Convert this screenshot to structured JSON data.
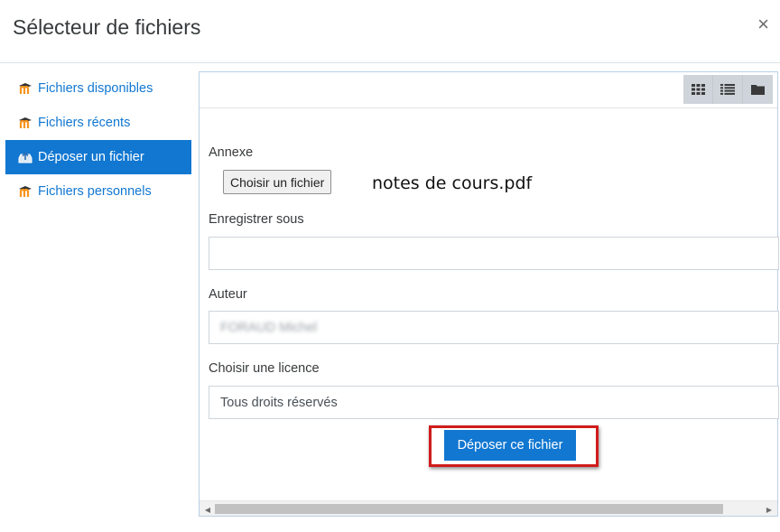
{
  "dialog": {
    "title": "Sélecteur de fichiers",
    "close_glyph": "×"
  },
  "colors": {
    "accent": "#1177d1",
    "highlight_border": "#d01b1b"
  },
  "sidebar": {
    "items": [
      {
        "label": "Fichiers disponibles",
        "icon": "moodle-icon",
        "active": false
      },
      {
        "label": "Fichiers récents",
        "icon": "moodle-icon",
        "active": false
      },
      {
        "label": "Déposer un fichier",
        "icon": "upload-icon",
        "active": true
      },
      {
        "label": "Fichiers personnels",
        "icon": "moodle-icon",
        "active": false
      }
    ]
  },
  "toolbar": {
    "view_icons": [
      "grid-view-icon",
      "list-view-icon",
      "folder-view-icon"
    ]
  },
  "form": {
    "attachment_label": "Annexe",
    "choose_button": "Choisir un fichier",
    "chosen_file": "notes de cours.pdf",
    "save_as_label": "Enregistrer sous",
    "save_as_value": "",
    "author_label": "Auteur",
    "author_value": "FORAUD Michel",
    "license_label": "Choisir une licence",
    "license_value": "Tous droits réservés",
    "upload_button": "Déposer ce fichier"
  }
}
